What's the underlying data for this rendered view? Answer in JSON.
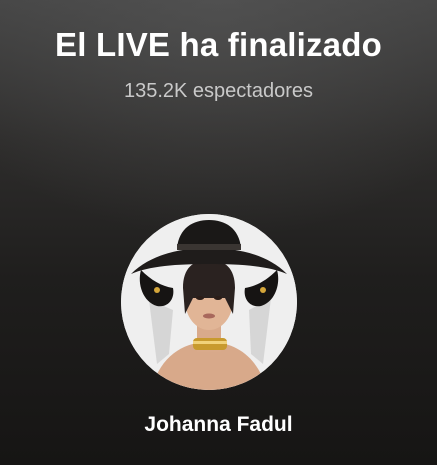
{
  "live_end": {
    "title": "El LIVE ha finalizado",
    "viewers": "135.2K espectadores"
  },
  "host": {
    "name": "Johanna Fadul",
    "avatar_icon": "profile-photo"
  },
  "colors": {
    "background_top": "#444444",
    "background_bottom": "#161514",
    "text_primary": "#ffffff",
    "text_secondary": "#c9c9c9"
  }
}
